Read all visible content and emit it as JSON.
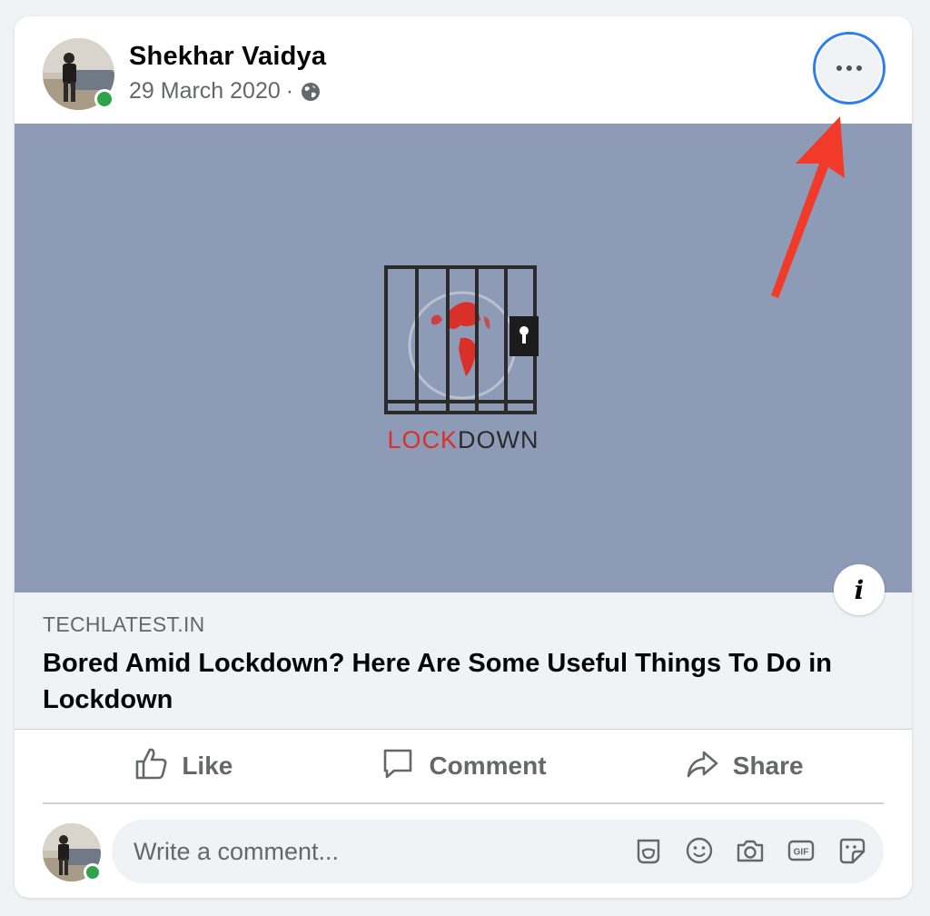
{
  "post": {
    "author": "Shekhar Vaidya",
    "date": "29 March 2020",
    "separator": "·",
    "privacy_icon": "globe-icon",
    "more_icon": "more-horizontal-icon"
  },
  "image": {
    "word_part_1": "LOCK",
    "word_part_2": "DOWN",
    "background": "#8e9bb6",
    "accent": "#d9302a"
  },
  "link": {
    "domain": "TECHLATEST.IN",
    "title": "Bored Amid Lockdown? Here Are Some Useful Things To Do in Lockdown",
    "info_icon": "info-icon",
    "info_glyph": "i"
  },
  "actions": [
    {
      "label": "Like",
      "icon": "thumbs-up-icon"
    },
    {
      "label": "Comment",
      "icon": "comment-icon"
    },
    {
      "label": "Share",
      "icon": "share-icon"
    }
  ],
  "comment": {
    "placeholder": "Write a comment...",
    "icons": [
      "avatar-sticker-icon",
      "emoji-icon",
      "camera-icon",
      "gif-icon",
      "sticker-icon"
    ]
  },
  "colors": {
    "online": "#31a24c",
    "highlight_ring": "#2d7ff0",
    "annotation_arrow": "#f23a2a"
  }
}
